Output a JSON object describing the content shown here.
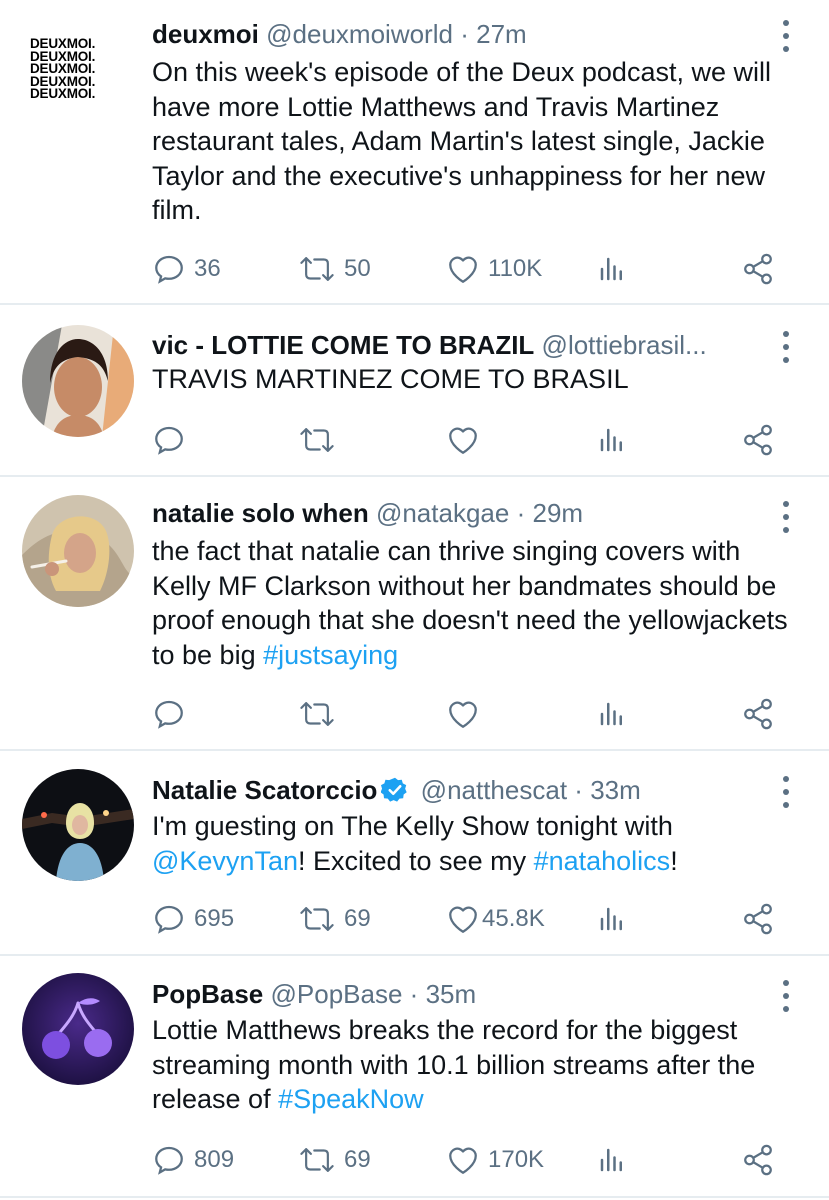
{
  "tweets": [
    {
      "name": "deuxmoi",
      "handle": "@deuxmoiworld",
      "sep": "·",
      "time": "27m",
      "avatar_icon": "deuxmoi-logo-icon",
      "logo_lines": [
        "DEUXMOI.",
        "DEUXMOI.",
        "DEUXMOI.",
        "DEUXMOI.",
        "DEUXMOI."
      ],
      "text": "On this week's episode of the Deux podcast, we will have more Lottie Matthews and Travis Martinez restaurant tales, Adam Martin's latest single, Jackie Taylor and the executive's unhappiness for her new film.",
      "replies": "36",
      "retweets": "50",
      "likes": "110K"
    },
    {
      "name": "vic - LOTTIE COME TO BRAZIL",
      "handle": "@lottiebrasil...",
      "text": "TRAVIS MARTINEZ COME TO BRASIL",
      "replies": "",
      "retweets": "",
      "likes": ""
    },
    {
      "name": "natalie solo when",
      "handle": "@natakgae",
      "sep": "·",
      "time": "29m",
      "text_plain": "the fact that natalie can thrive singing covers with Kelly MF Clarkson without her bandmates should be proof enough that she doesn't need the yellowjackets to be big ",
      "hashtag": "#justsaying",
      "replies": "",
      "retweets": "",
      "likes": ""
    },
    {
      "name": "Natalie Scatorccio",
      "handle": "@natthescat",
      "sep": "·",
      "time": "33m",
      "text_1": "I'm guesting on The Kelly Show tonight with ",
      "mention": "@KevynTan",
      "text_2": "! Excited to see my ",
      "hashtag": "#nataholics",
      "text_3": "!",
      "replies": "695",
      "retweets": "69",
      "likes": "45.8K"
    },
    {
      "name": "PopBase",
      "handle": "@PopBase",
      "sep": "·",
      "time": "35m",
      "text_plain": "Lottie Matthews breaks the record for the biggest streaming month with 10.1 billion streams after the release of ",
      "hashtag": "#SpeakNow",
      "replies": "809",
      "retweets": "69",
      "likes": "170K"
    }
  ],
  "colors": {
    "text": "#0f1419",
    "secondary": "#5b7083",
    "link": "#1da1f2",
    "divider": "#e6ecf0",
    "verified": "#1da1f2"
  }
}
